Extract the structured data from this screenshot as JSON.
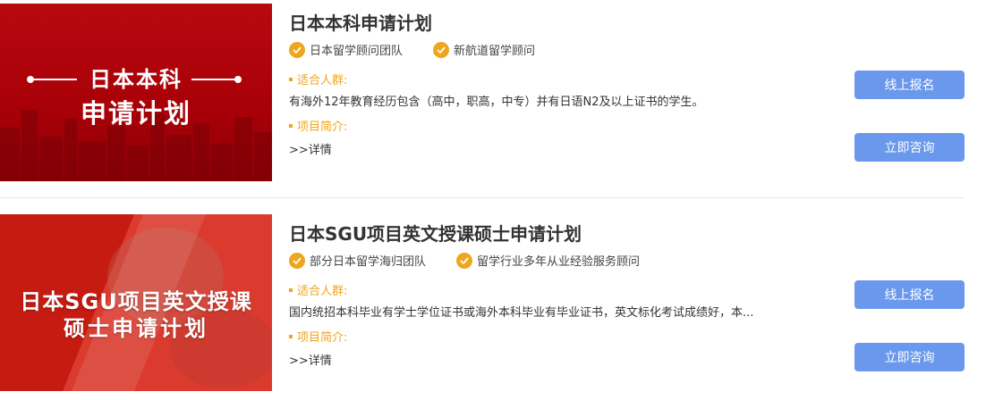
{
  "programs": [
    {
      "banner_line1": "日本本科",
      "banner_line2": "申请计划",
      "title": "日本本科申请计划",
      "tags": [
        "日本留学顾问团队",
        "新航道留学顾问"
      ],
      "audience_label": "适合人群:",
      "audience_text": "有海外12年教育经历包含（高中，职高，中专）并有日语N2及以上证书的学生。",
      "intro_label": "项目简介:",
      "more_link": ">>详情",
      "signup_button": "线上报名",
      "consult_button": "立即咨询"
    },
    {
      "banner_line1": "日本SGU项目英文授课",
      "banner_line2": "硕士申请计划",
      "title": "日本SGU项目英文授课硕士申请计划",
      "tags": [
        "部分日本留学海归团队",
        "留学行业多年从业经验服务顾问"
      ],
      "audience_label": "适合人群:",
      "audience_text": "国内统招本科毕业有学士学位证书或海外本科毕业有毕业证书，英文标化考试成绩好，本...",
      "intro_label": "项目简介:",
      "more_link": ">>详情",
      "signup_button": "线上报名",
      "consult_button": "立即咨询"
    }
  ],
  "colors": {
    "accent_orange": "#f0a51e",
    "button_blue": "#6a98ec",
    "banner_red_dark": "#b80810",
    "banner_red": "#d6281e"
  },
  "icons": {
    "tag_icon": "check-circle-icon"
  }
}
